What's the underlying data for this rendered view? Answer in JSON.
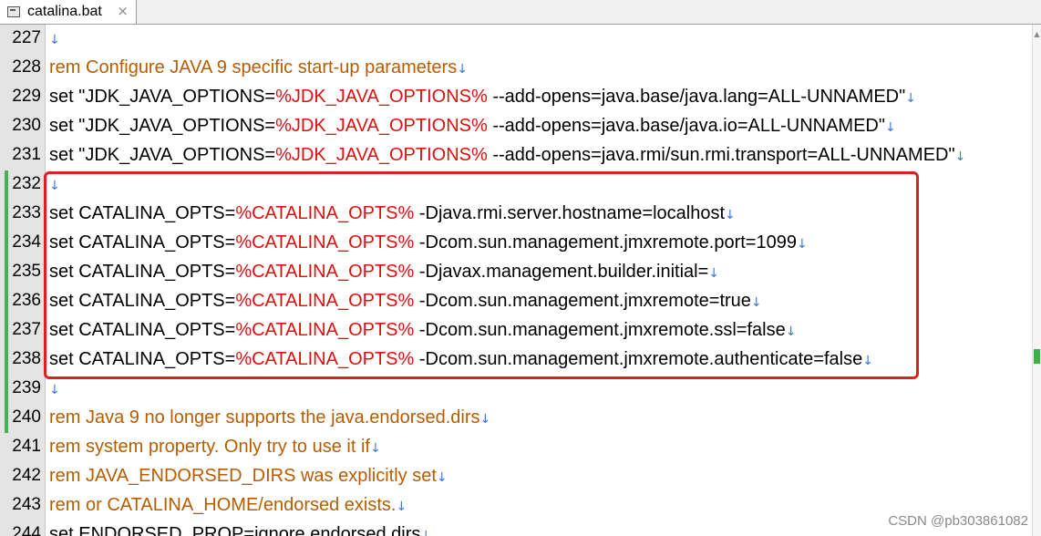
{
  "tab": {
    "title": "catalina.bat",
    "icon": "file-icon",
    "close": "×"
  },
  "eol_glyph": "↓",
  "lines": [
    {
      "num": "227",
      "changed": false,
      "segments": []
    },
    {
      "num": "228",
      "changed": false,
      "segments": [
        {
          "t": "rem Configure JAVA 9 specific start-up parameters",
          "c": "rem"
        }
      ]
    },
    {
      "num": "229",
      "changed": false,
      "segments": [
        {
          "t": "set \"JDK_JAVA_OPTIONS=",
          "c": "plain"
        },
        {
          "t": "%JDK_JAVA_OPTIONS%",
          "c": "var"
        },
        {
          "t": " --add-opens=java.base/java.lang=ALL-UNNAMED\"",
          "c": "plain"
        }
      ]
    },
    {
      "num": "230",
      "changed": false,
      "segments": [
        {
          "t": "set \"JDK_JAVA_OPTIONS=",
          "c": "plain"
        },
        {
          "t": "%JDK_JAVA_OPTIONS%",
          "c": "var"
        },
        {
          "t": " --add-opens=java.base/java.io=ALL-UNNAMED\"",
          "c": "plain"
        }
      ]
    },
    {
      "num": "231",
      "changed": false,
      "segments": [
        {
          "t": "set \"JDK_JAVA_OPTIONS=",
          "c": "plain"
        },
        {
          "t": "%JDK_JAVA_OPTIONS%",
          "c": "var"
        },
        {
          "t": " --add-opens=java.rmi/sun.rmi.transport=ALL-UNNAMED\"",
          "c": "plain"
        }
      ]
    },
    {
      "num": "232",
      "changed": true,
      "segments": []
    },
    {
      "num": "233",
      "changed": true,
      "segments": [
        {
          "t": "set CATALINA_OPTS=",
          "c": "plain"
        },
        {
          "t": "%CATALINA_OPTS%",
          "c": "var"
        },
        {
          "t": " -Djava.rmi.server.hostname=localhost",
          "c": "plain"
        }
      ]
    },
    {
      "num": "234",
      "changed": true,
      "segments": [
        {
          "t": "set CATALINA_OPTS=",
          "c": "plain"
        },
        {
          "t": "%CATALINA_OPTS%",
          "c": "var"
        },
        {
          "t": " -Dcom.sun.management.jmxremote.port=1099",
          "c": "plain"
        }
      ]
    },
    {
      "num": "235",
      "changed": true,
      "segments": [
        {
          "t": "set CATALINA_OPTS=",
          "c": "plain"
        },
        {
          "t": "%CATALINA_OPTS%",
          "c": "var"
        },
        {
          "t": " -Djavax.management.builder.initial=",
          "c": "plain"
        }
      ]
    },
    {
      "num": "236",
      "changed": true,
      "segments": [
        {
          "t": "set CATALINA_OPTS=",
          "c": "plain"
        },
        {
          "t": "%CATALINA_OPTS%",
          "c": "var"
        },
        {
          "t": " -Dcom.sun.management.jmxremote=true",
          "c": "plain"
        }
      ]
    },
    {
      "num": "237",
      "changed": true,
      "segments": [
        {
          "t": "set CATALINA_OPTS=",
          "c": "plain"
        },
        {
          "t": "%CATALINA_OPTS%",
          "c": "var"
        },
        {
          "t": " -Dcom.sun.management.jmxremote.ssl=false",
          "c": "plain"
        }
      ]
    },
    {
      "num": "238",
      "changed": true,
      "segments": [
        {
          "t": "set CATALINA_OPTS=",
          "c": "plain"
        },
        {
          "t": "%CATALINA_OPTS%",
          "c": "var"
        },
        {
          "t": " -Dcom.sun.management.jmxremote.authenticate=false",
          "c": "plain"
        }
      ]
    },
    {
      "num": "239",
      "changed": true,
      "segments": []
    },
    {
      "num": "240",
      "changed": true,
      "segments": [
        {
          "t": "rem Java 9 no longer supports the java.endorsed.dirs",
          "c": "rem"
        }
      ]
    },
    {
      "num": "241",
      "changed": false,
      "segments": [
        {
          "t": "rem system property. Only try to use it if",
          "c": "rem"
        }
      ]
    },
    {
      "num": "242",
      "changed": false,
      "segments": [
        {
          "t": "rem JAVA_ENDORSED_DIRS was explicitly set",
          "c": "rem"
        }
      ]
    },
    {
      "num": "243",
      "changed": false,
      "segments": [
        {
          "t": "rem or CATALINA_HOME/endorsed exists.",
          "c": "rem"
        }
      ]
    },
    {
      "num": "244",
      "changed": false,
      "segments": [
        {
          "t": "set ENDORSED_PROP=ignore.endorsed.dirs",
          "c": "plain"
        }
      ]
    }
  ],
  "watermark": "CSDN @pb303861082",
  "colors": {
    "rem": "#b85c00",
    "var": "#e01010",
    "plain": "#000000",
    "eol": "#3a7bd5",
    "change_marker": "#4caf50",
    "highlight_box": "#e0201a"
  }
}
